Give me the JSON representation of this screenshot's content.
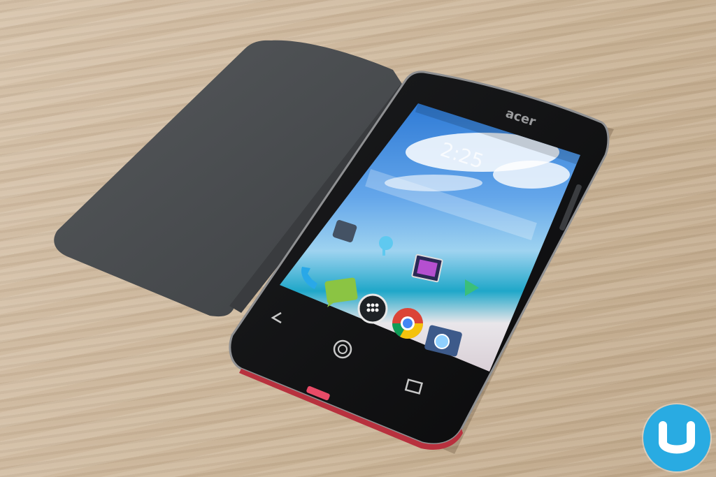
{
  "phone": {
    "brand": "acer",
    "status_time": "2:25",
    "dock_apps": [
      {
        "icon": "phone-icon"
      },
      {
        "icon": "messaging-icon"
      },
      {
        "icon": "app-drawer-icon"
      },
      {
        "icon": "chrome-icon"
      },
      {
        "icon": "camera-icon"
      }
    ],
    "home_apps": [
      {
        "icon": "tools-folder-icon"
      },
      {
        "icon": "weather-icon"
      },
      {
        "icon": "gallery-icon"
      },
      {
        "icon": "play-store-icon"
      }
    ],
    "nav_buttons": [
      "back-button-icon",
      "home-button-icon",
      "recents-button-icon"
    ]
  },
  "colors": {
    "table_wood": "#cfb99d",
    "phone_body": "#121314",
    "flip_cover": "#4a4d50",
    "logo_blue": "#29abe2"
  },
  "watermark_logo": {
    "letter": "U"
  }
}
